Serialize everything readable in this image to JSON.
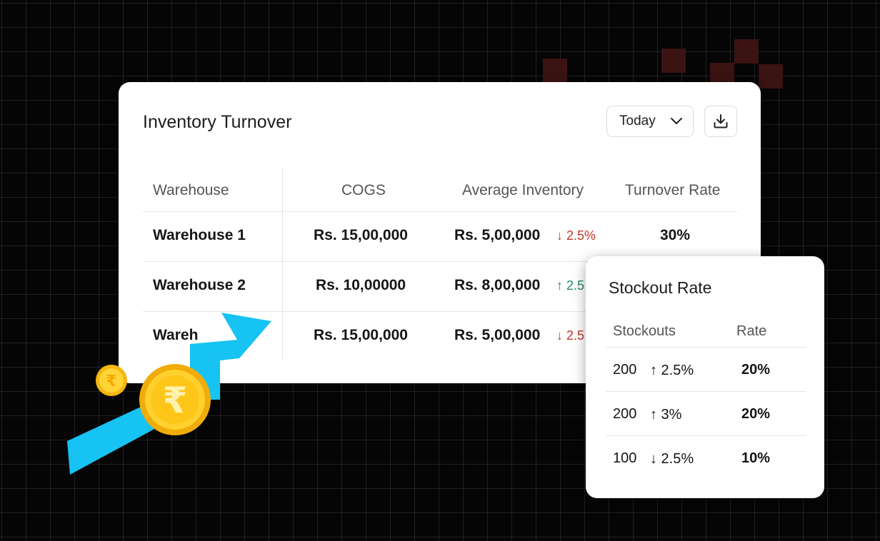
{
  "inventory": {
    "title": "Inventory Turnover",
    "period": "Today",
    "columns": [
      "Warehouse",
      "COGS",
      "Average Inventory",
      "Turnover Rate"
    ],
    "rows": [
      {
        "warehouse": "Warehouse 1",
        "cogs": "Rs. 15,00,000",
        "avg_inventory": "Rs. 5,00,000",
        "delta": "↓ 2.5%",
        "direction": "down",
        "turnover": "30%"
      },
      {
        "warehouse": "Warehouse 2",
        "cogs": "Rs. 10,00000",
        "avg_inventory": "Rs. 8,00,000",
        "delta": "↑ 2.5",
        "direction": "up",
        "turnover": ""
      },
      {
        "warehouse": "Wareh",
        "cogs": "Rs. 15,00,000",
        "avg_inventory": "Rs. 5,00,000",
        "delta": "↓ 2.5",
        "direction": "down",
        "turnover": ""
      }
    ]
  },
  "stockout": {
    "title": "Stockout Rate",
    "columns": [
      "Stockouts",
      "Rate"
    ],
    "rows": [
      {
        "stockouts": "200",
        "delta": "↑ 2.5%",
        "direction": "up",
        "rate": "20%"
      },
      {
        "stockouts": "200",
        "delta": "↑ 3%",
        "direction": "up",
        "rate": "20%"
      },
      {
        "stockouts": "100",
        "delta": "↓ 2.5%",
        "direction": "down",
        "rate": "10%"
      }
    ]
  },
  "icons": {
    "period_dropdown": "chevron-down-icon",
    "download": "download-icon",
    "decoration": "rupee-coin-icon"
  },
  "colors": {
    "up": "#1f8a5b",
    "down": "#c0392b",
    "arrow": "#16c3f2",
    "coin": "#f7c21b"
  }
}
